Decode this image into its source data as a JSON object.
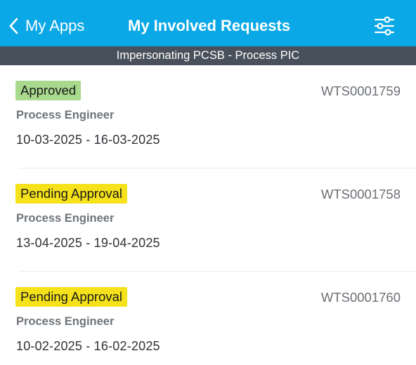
{
  "header": {
    "back_label": "My Apps",
    "title": "My Involved Requests",
    "back_icon": "chevron-left-icon",
    "filter_icon": "sliders-icon",
    "bg_color": "#0aa8e6"
  },
  "impersonation_banner": {
    "text": "Impersonating PCSB - Process PIC",
    "bg_color": "#48505b"
  },
  "requests": [
    {
      "status": "Approved",
      "status_color": "#a8d98d",
      "request_id": "WTS0001759",
      "role": "Process Engineer",
      "dates": "10-03-2025 - 16-03-2025"
    },
    {
      "status": "Pending Approval",
      "status_color": "#f5e21a",
      "request_id": "WTS0001758",
      "role": "Process Engineer",
      "dates": "13-04-2025 - 19-04-2025"
    },
    {
      "status": "Pending Approval",
      "status_color": "#f5e21a",
      "request_id": "WTS0001760",
      "role": "Process Engineer",
      "dates": "10-02-2025 - 16-02-2025"
    }
  ]
}
